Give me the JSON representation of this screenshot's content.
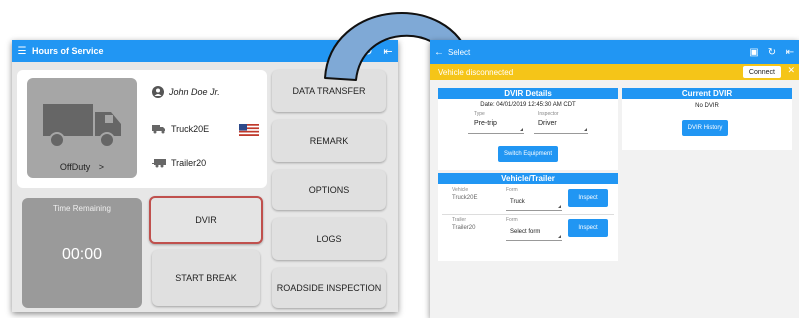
{
  "left": {
    "title": "Hours of Service",
    "driver_name": "John Doe Jr.",
    "truck": "Truck20E",
    "trailer": "Trailer20",
    "status": "OffDuty",
    "status_chevron": ">",
    "timer_label": "Time Remaining",
    "timer_value": "00:00",
    "buttons": {
      "data_transfer": "DATA TRANSFER",
      "remark": "REMARK",
      "options": "OPTIONS",
      "dvir": "DVIR",
      "logs": "LOGS",
      "start_break": "START BREAK",
      "roadside": "ROADSIDE INSPECTION"
    }
  },
  "right": {
    "title": "Select",
    "warning": "Vehicle disconnected",
    "connect": "Connect",
    "dvir_details": {
      "header": "DVIR Details",
      "date": "Date: 04/01/2019 12:45:30 AM CDT",
      "type_label": "Type",
      "type_value": "Pre-trip",
      "inspector_label": "Inspector",
      "inspector_value": "Driver",
      "switch_button": "Switch Equipment"
    },
    "current_dvir": {
      "header": "Current DVIR",
      "status": "No DVIR",
      "history_button": "DVIR History"
    },
    "vehicle_trailer": {
      "header": "Vehicle/Trailer",
      "vehicle_label": "Vehicle",
      "vehicle_value": "Truck20E",
      "form_label": "Form",
      "vehicle_form_value": "Truck",
      "trailer_label": "Trailer",
      "trailer_value": "Trailer20",
      "trailer_form_value": "Select form",
      "inspect_button": "Inspect"
    }
  },
  "colors": {
    "primary": "#2196f3",
    "warning": "#f5c518",
    "highlight": "#c0504d"
  }
}
